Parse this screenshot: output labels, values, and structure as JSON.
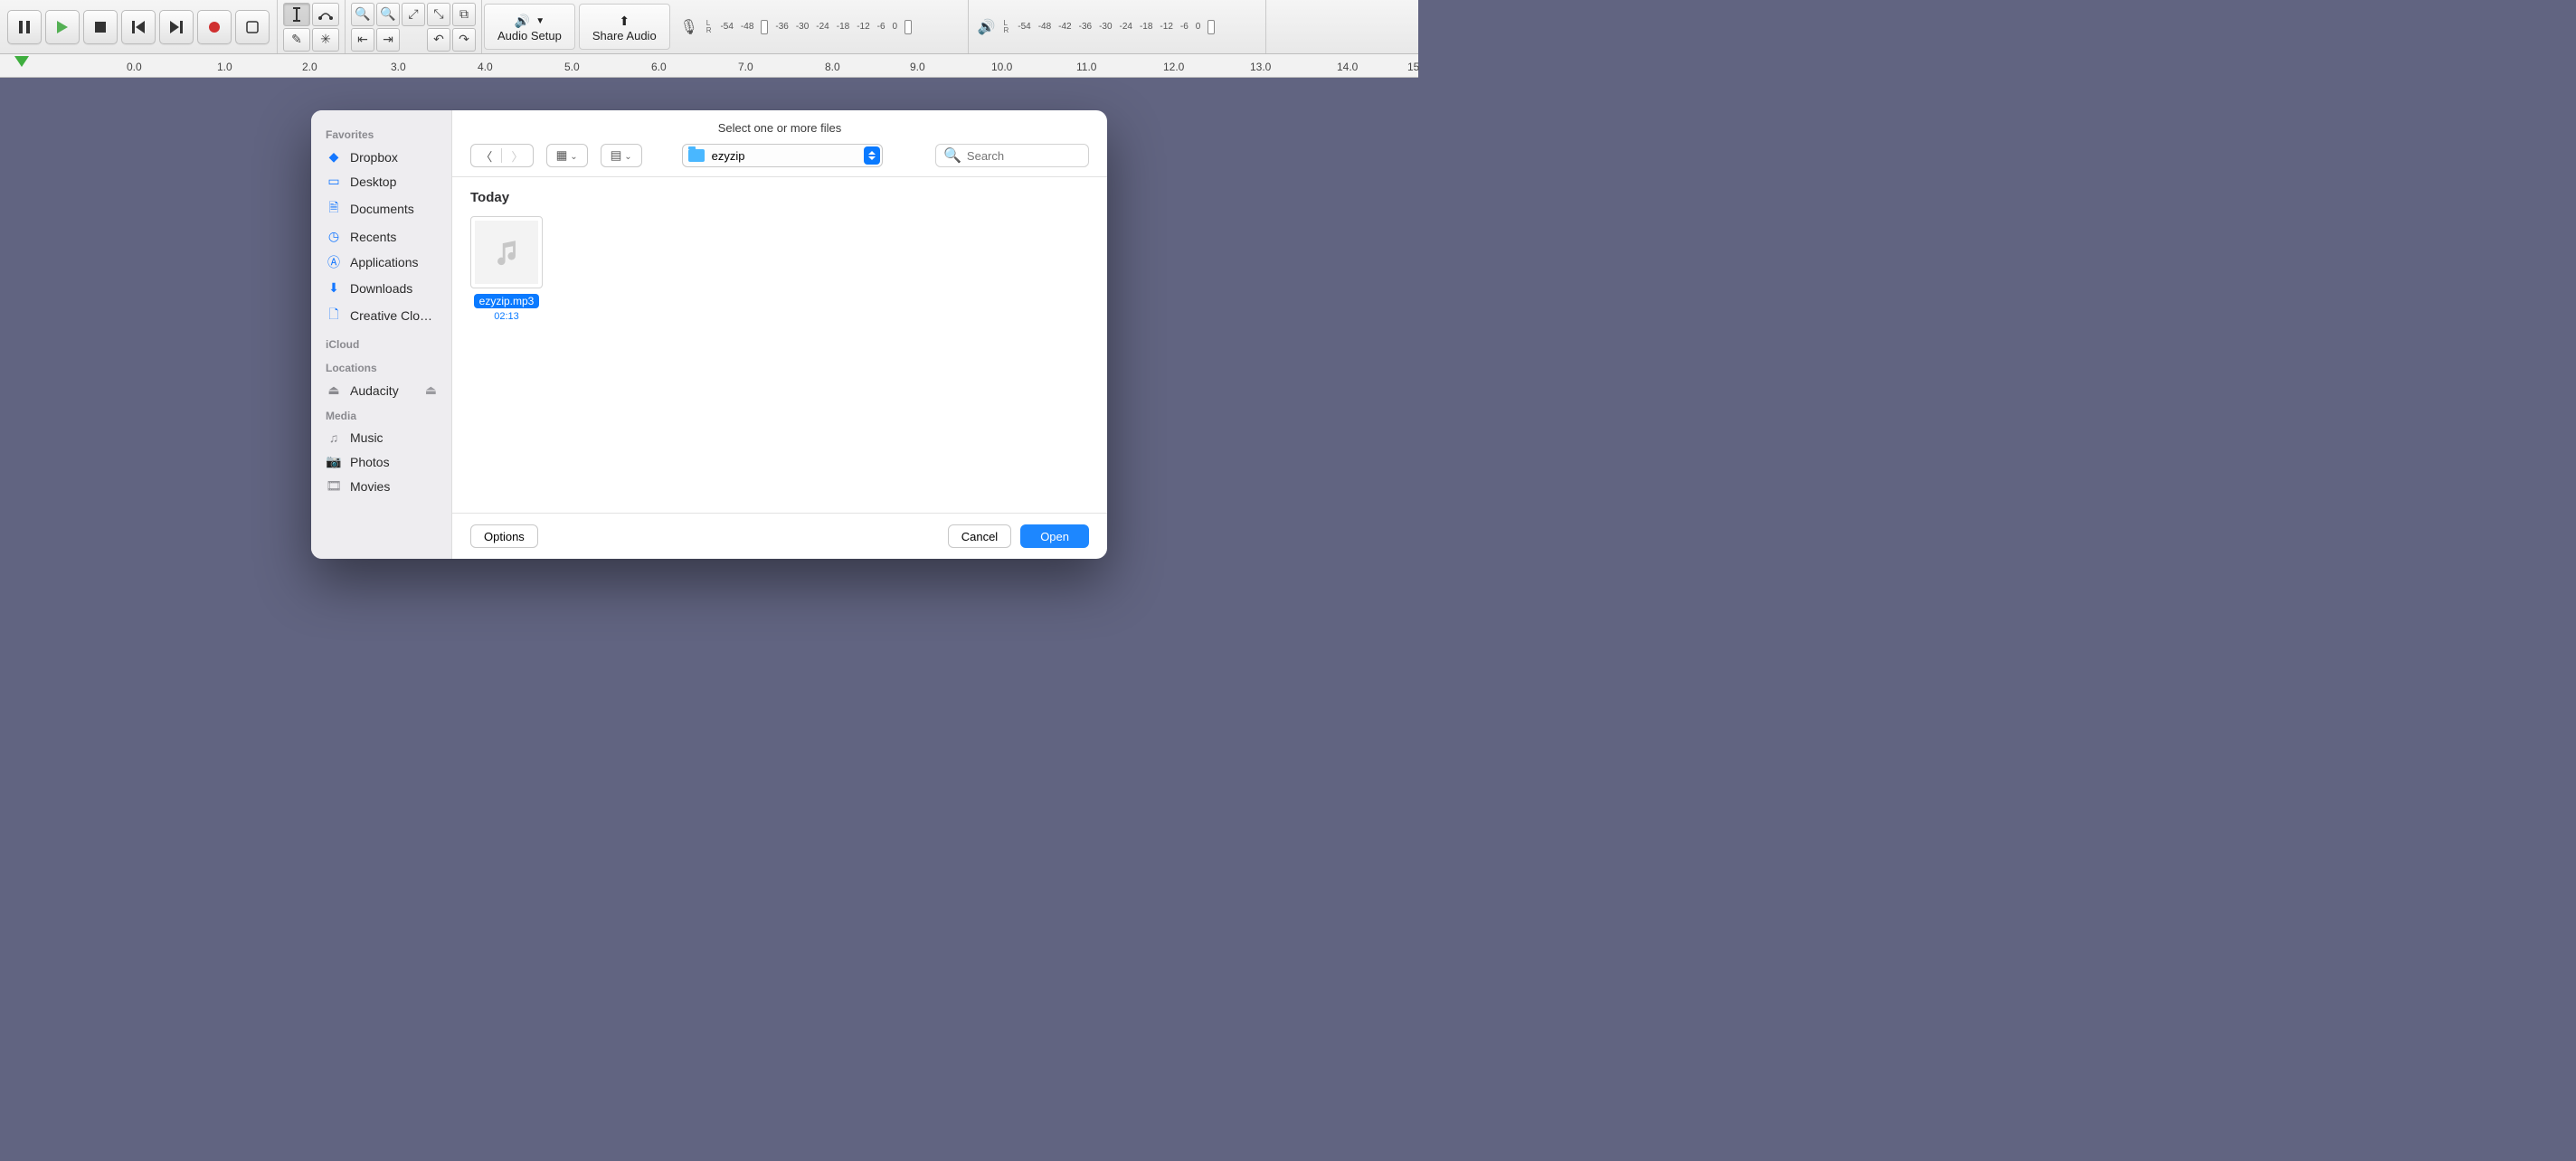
{
  "toolbar": {
    "transport": {
      "pause": "pause",
      "play": "play",
      "stop": "stop",
      "skip_start": "skip-start",
      "skip_end": "skip-end",
      "record": "record",
      "loop": "loop"
    },
    "audio_setup_label": "Audio Setup",
    "share_audio_label": "Share Audio",
    "meter_ticks": [
      "-54",
      "-48",
      "-42",
      "-36",
      "-30",
      "-24",
      "-18",
      "-12",
      "-6",
      "0"
    ],
    "lr": {
      "L": "L",
      "R": "R"
    }
  },
  "timeline": {
    "marks": [
      "0.0",
      "1.0",
      "2.0",
      "3.0",
      "4.0",
      "5.0",
      "6.0",
      "7.0",
      "8.0",
      "9.0",
      "10.0",
      "11.0",
      "12.0",
      "13.0",
      "14.0",
      "15"
    ]
  },
  "dialog": {
    "title": "Select one or more files",
    "path": "ezyzip",
    "search_placeholder": "Search",
    "section": "Today",
    "file": {
      "name": "ezyzip.mp3",
      "duration": "02:13"
    },
    "buttons": {
      "options": "Options",
      "cancel": "Cancel",
      "open": "Open"
    },
    "sidebar": {
      "favorites_head": "Favorites",
      "favorites": [
        {
          "label": "Dropbox",
          "icon": "dropbox"
        },
        {
          "label": "Desktop",
          "icon": "desktop"
        },
        {
          "label": "Documents",
          "icon": "doc"
        },
        {
          "label": "Recents",
          "icon": "clock"
        },
        {
          "label": "Applications",
          "icon": "apps"
        },
        {
          "label": "Downloads",
          "icon": "down"
        },
        {
          "label": "Creative Clo…",
          "icon": "file"
        }
      ],
      "icloud_head": "iCloud",
      "locations_head": "Locations",
      "locations": [
        {
          "label": "Audacity",
          "icon": "disk",
          "eject": true
        }
      ],
      "media_head": "Media",
      "media": [
        {
          "label": "Music",
          "icon": "music"
        },
        {
          "label": "Photos",
          "icon": "camera"
        },
        {
          "label": "Movies",
          "icon": "film"
        }
      ]
    }
  }
}
